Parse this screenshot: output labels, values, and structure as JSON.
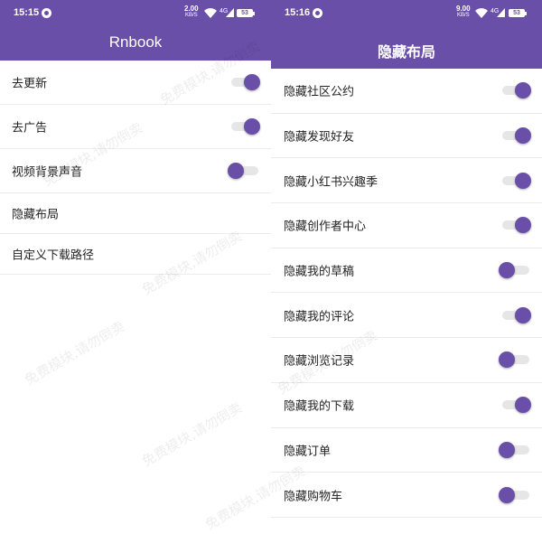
{
  "left": {
    "status": {
      "time": "15:15",
      "speed": "2.00",
      "speed_unit": "KB/S",
      "network": "4G",
      "battery": "53"
    },
    "title": "Rnbook",
    "items": [
      {
        "label": "去更新",
        "toggle": true
      },
      {
        "label": "去广告",
        "toggle": true
      },
      {
        "label": "视频背景声音",
        "toggle": false
      },
      {
        "label": "隐藏布局"
      },
      {
        "label": "自定义下载路径"
      }
    ]
  },
  "right": {
    "status": {
      "time": "15:16",
      "speed": "9.00",
      "speed_unit": "KB/S",
      "network": "4G",
      "battery": "53"
    },
    "title": "隐藏布局",
    "items": [
      {
        "label": "隐藏社区公约",
        "toggle": true
      },
      {
        "label": "隐藏发现好友",
        "toggle": true
      },
      {
        "label": "隐藏小红书兴趣季",
        "toggle": true
      },
      {
        "label": "隐藏创作者中心",
        "toggle": true
      },
      {
        "label": "隐藏我的草稿",
        "toggle": false
      },
      {
        "label": "隐藏我的评论",
        "toggle": true
      },
      {
        "label": "隐藏浏览记录",
        "toggle": false
      },
      {
        "label": "隐藏我的下载",
        "toggle": true
      },
      {
        "label": "隐藏订单",
        "toggle": false
      },
      {
        "label": "隐藏购物车",
        "toggle": false
      }
    ]
  },
  "watermark": "免费模块,请勿倒卖",
  "colors": {
    "accent": "#6a4fa8",
    "track": "#e6e6e6",
    "divider": "#ececec"
  }
}
